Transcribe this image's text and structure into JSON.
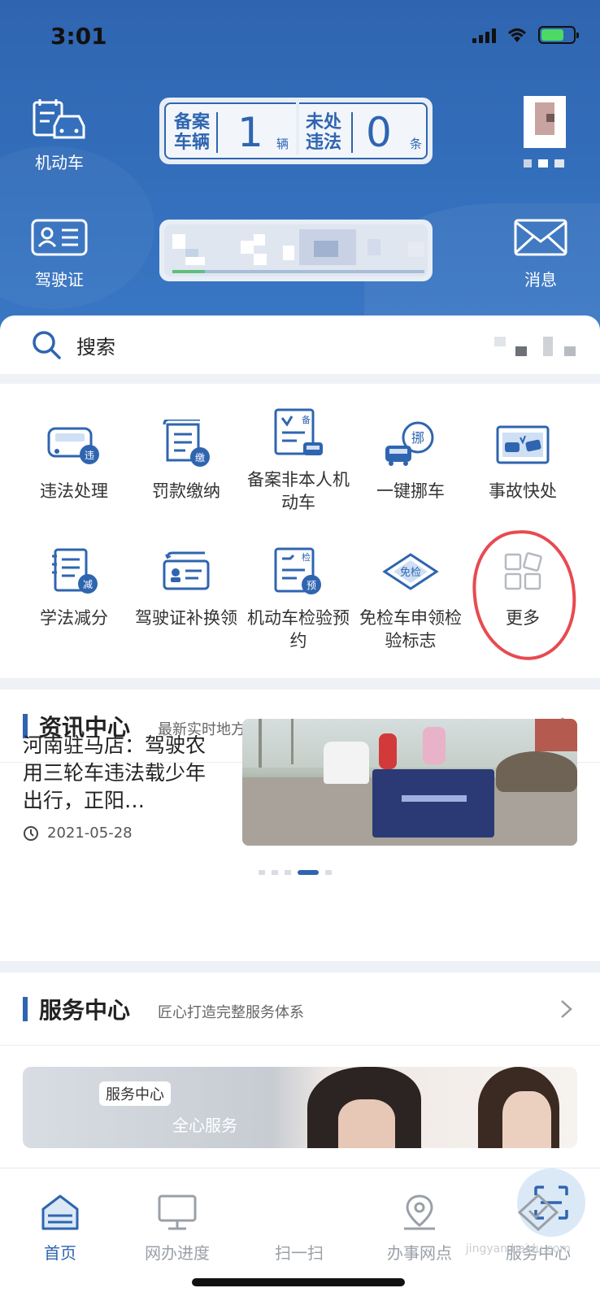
{
  "status": {
    "time": "3:01"
  },
  "header": {
    "vehicle_label": "机动车",
    "license_label": "驾驶证",
    "message_label": "消息",
    "plate": {
      "left_label_1": "备案",
      "left_label_2": "车辆",
      "count": "1",
      "count_unit": "辆",
      "right_label_1": "未处",
      "right_label_2": "违法",
      "violations": "0",
      "violations_unit": "条"
    }
  },
  "search": {
    "label": "搜索"
  },
  "services": [
    {
      "label": "违法处理",
      "icon": "violation-car-icon"
    },
    {
      "label": "罚款缴纳",
      "icon": "fine-payment-icon"
    },
    {
      "label": "备案非本人机动车",
      "icon": "register-vehicle-icon"
    },
    {
      "label": "一键挪车",
      "icon": "move-car-icon"
    },
    {
      "label": "事故快处",
      "icon": "accident-icon"
    },
    {
      "label": "学法减分",
      "icon": "study-points-icon"
    },
    {
      "label": "驾驶证补换领",
      "icon": "license-replace-icon"
    },
    {
      "label": "机动车检验预约",
      "icon": "inspection-booking-icon"
    },
    {
      "label": "免检车申领检验标志",
      "icon": "exempt-badge-icon"
    },
    {
      "label": "更多",
      "icon": "more-grid-icon"
    }
  ],
  "news": {
    "title": "资讯中心",
    "subtitle": "最新实时地方交通资讯",
    "item_title": "河南驻马店：驾驶农用三轮车违法载少年出行，正阳…",
    "item_date": "2021-05-28"
  },
  "service_center": {
    "title": "服务中心",
    "subtitle": "匠心打造完整服务体系",
    "banner_tag": "服务中心",
    "banner_text": "全心服务"
  },
  "tabs": [
    {
      "label": "首页",
      "active": true
    },
    {
      "label": "网办进度",
      "active": false
    },
    {
      "label": "扫一扫",
      "active": false
    },
    {
      "label": "办事网点",
      "active": false
    },
    {
      "label": "服务中心",
      "active": false
    }
  ],
  "watermark": "jingyan.baidu.com",
  "colors": {
    "primary": "#2f65b0",
    "annotation_ring": "#e84a50"
  }
}
